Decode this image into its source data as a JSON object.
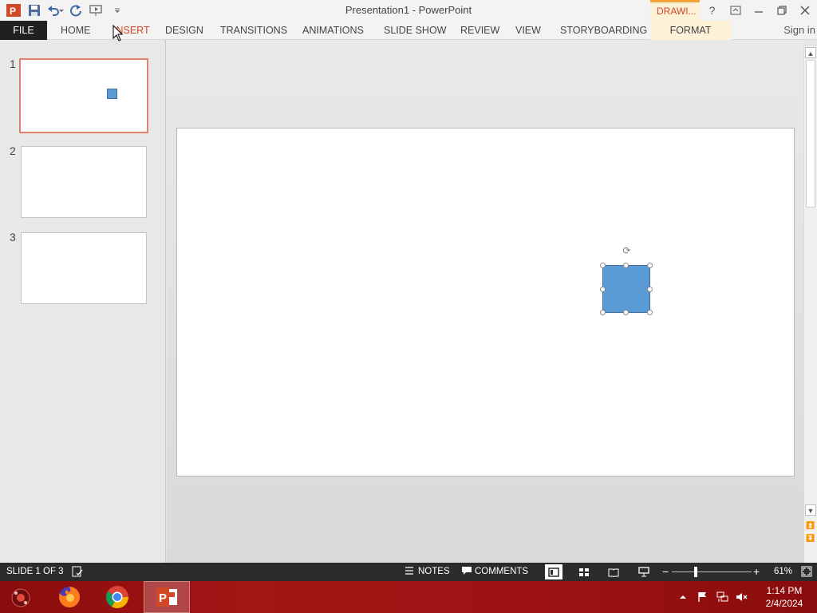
{
  "window": {
    "title": "Presentation1 - PowerPoint",
    "contextual_group": "DRAWI...",
    "help": "?",
    "sign_in": "Sign in"
  },
  "ribbon": {
    "tabs": [
      "FILE",
      "HOME",
      "INSERT",
      "DESIGN",
      "TRANSITIONS",
      "ANIMATIONS",
      "SLIDE SHOW",
      "REVIEW",
      "VIEW",
      "STORYBOARDING",
      "FORMAT"
    ],
    "active_tab": "INSERT"
  },
  "slides_pane": {
    "numbers": [
      "1",
      "2",
      "3"
    ],
    "selected": 1
  },
  "status": {
    "slide_indicator": "SLIDE 1 OF 3",
    "notes": "NOTES",
    "comments": "COMMENTS",
    "zoom_minus": "−",
    "zoom_plus": "+",
    "zoom_level": "61%"
  },
  "taskbar": {
    "time": "1:14 PM",
    "date": "2/4/2024"
  },
  "colors": {
    "accent": "#d24726",
    "shape_fill": "#5b9bd5",
    "shape_outline": "#41719c",
    "status_bar": "#2b2b2b",
    "taskbar": "#9b1212"
  }
}
